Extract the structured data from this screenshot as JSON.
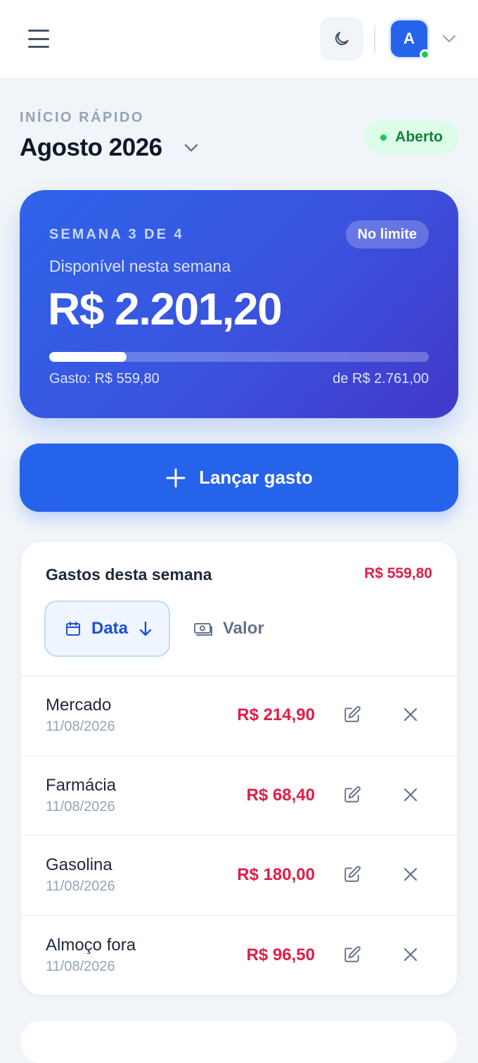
{
  "header": {
    "avatar_initial": "A"
  },
  "period": {
    "eyebrow": "INÍCIO RÁPIDO",
    "title": "Agosto 2026",
    "status": "Aberto"
  },
  "hero": {
    "week": "SEMANA 3 DE 4",
    "limit_badge": "No limite",
    "caption": "Disponível nesta semana",
    "available": "R$ 2.201,20",
    "spent_label": "Gasto: R$ 559,80",
    "total_label": "de R$ 2.761,00",
    "progress_percent": 20.3
  },
  "actions": {
    "add_expense": "Lançar gasto"
  },
  "expenses": {
    "title": "Gastos desta semana",
    "total": "R$ 559,80",
    "sort_date": "Data",
    "sort_value": "Valor",
    "items": [
      {
        "name": "Mercado",
        "date": "11/08/2026",
        "amount": "R$ 214,90"
      },
      {
        "name": "Farmácia",
        "date": "11/08/2026",
        "amount": "R$ 68,40"
      },
      {
        "name": "Gasolina",
        "date": "11/08/2026",
        "amount": "R$ 180,00"
      },
      {
        "name": "Almoço fora",
        "date": "11/08/2026",
        "amount": "R$ 96,50"
      }
    ]
  },
  "colors": {
    "primary": "#2563eb",
    "expense": "#e11d48",
    "status_open": "#15803d"
  },
  "icons": {
    "menu": "hamburger-menu-icon",
    "theme": "moon-icon",
    "caret": "chevron-down-icon",
    "add": "plus-icon",
    "sort_date": "calendar-icon",
    "sort_direction": "arrow-down-icon",
    "sort_value": "money-icon",
    "edit": "edit-icon",
    "delete": "close-icon"
  }
}
